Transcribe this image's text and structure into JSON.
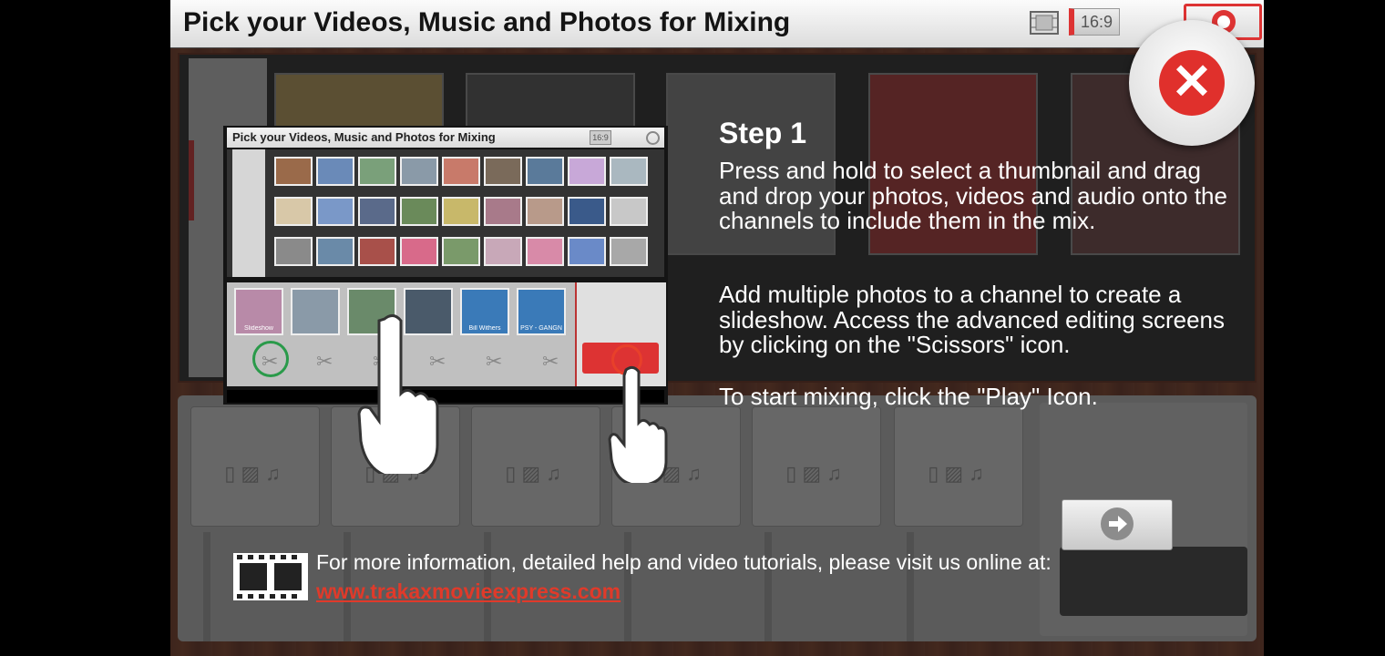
{
  "header": {
    "title": "Pick your Videos, Music and Photos for Mixing",
    "aspect_ratio": "16:9"
  },
  "tutorial_image": {
    "title": "Pick your Videos, Music and Photos for Mixing",
    "aspect_ratio": "16:9",
    "channel_labels": [
      "Slideshow",
      "Bill Withers",
      "PSY - GANGN"
    ]
  },
  "step": {
    "heading": "Step 1",
    "para1": "Press and hold to select a thumbnail and drag and drop your photos, videos and audio onto the channels to include them in the mix.",
    "para2": "Add multiple photos to a channel to create a slideshow. Access the advanced editing screens by clicking on the \"Scissors\" icon.",
    "para3": "To start mixing, click the \"Play\" Icon."
  },
  "footer": {
    "info": "For more information, detailed help and video tutorials, please visit us online at:",
    "link": "www.trakaxmovieexpress.com"
  },
  "icons": {
    "close": "close-icon",
    "next": "arrow-right-icon",
    "help": "lifebuoy-icon",
    "film": "film-strip-icon",
    "aspect": "film-frame-icon"
  },
  "colors": {
    "accent": "#e0302c",
    "link": "#e03a2a",
    "overlay": "#191919"
  }
}
